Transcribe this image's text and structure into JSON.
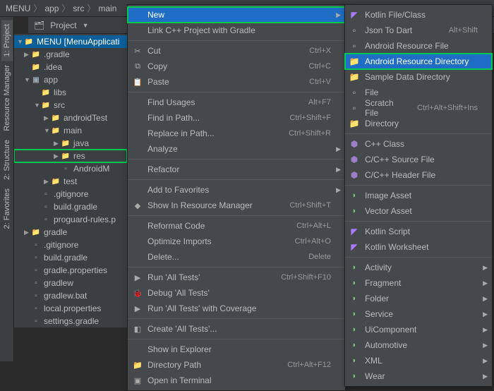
{
  "breadcrumb": [
    "MENU",
    "app",
    "src",
    "main"
  ],
  "toolbar": {
    "mode": "Project"
  },
  "side_tabs": [
    "1: Project",
    "Resource Manager",
    "2: Structure",
    "2: Favorites"
  ],
  "tree": [
    {
      "pad": 0,
      "ar": "▼",
      "ico": "folder",
      "txt": "MENU [MenuApplicati",
      "sel": true
    },
    {
      "pad": 1,
      "ar": "▶",
      "ico": "folder-o",
      "txt": ".gradle"
    },
    {
      "pad": 1,
      "ar": "",
      "ico": "folder",
      "txt": ".idea"
    },
    {
      "pad": 1,
      "ar": "▼",
      "ico": "mod",
      "txt": "app"
    },
    {
      "pad": 2,
      "ar": "",
      "ico": "folder",
      "txt": "libs"
    },
    {
      "pad": 2,
      "ar": "▼",
      "ico": "folder",
      "txt": "src"
    },
    {
      "pad": 3,
      "ar": "▶",
      "ico": "folder",
      "txt": "androidTest"
    },
    {
      "pad": 3,
      "ar": "▼",
      "ico": "folder",
      "txt": "main"
    },
    {
      "pad": 4,
      "ar": "▶",
      "ico": "folder",
      "txt": "java"
    },
    {
      "pad": 4,
      "ar": "▶",
      "ico": "folder",
      "txt": "res",
      "hl": true
    },
    {
      "pad": 4,
      "ar": "",
      "ico": "file",
      "txt": "AndroidM"
    },
    {
      "pad": 3,
      "ar": "▶",
      "ico": "folder",
      "txt": "test"
    },
    {
      "pad": 2,
      "ar": "",
      "ico": "file",
      "txt": ".gitignore"
    },
    {
      "pad": 2,
      "ar": "",
      "ico": "file",
      "txt": "build.gradle"
    },
    {
      "pad": 2,
      "ar": "",
      "ico": "file",
      "txt": "proguard-rules.p"
    },
    {
      "pad": 1,
      "ar": "▶",
      "ico": "folder",
      "txt": "gradle"
    },
    {
      "pad": 1,
      "ar": "",
      "ico": "file",
      "txt": ".gitignore"
    },
    {
      "pad": 1,
      "ar": "",
      "ico": "file",
      "txt": "build.gradle"
    },
    {
      "pad": 1,
      "ar": "",
      "ico": "file",
      "txt": "gradle.properties"
    },
    {
      "pad": 1,
      "ar": "",
      "ico": "file",
      "txt": "gradlew"
    },
    {
      "pad": 1,
      "ar": "",
      "ico": "file",
      "txt": "gradlew.bat"
    },
    {
      "pad": 1,
      "ar": "",
      "ico": "file",
      "txt": "local.properties"
    },
    {
      "pad": 1,
      "ar": "",
      "ico": "file",
      "txt": "settings.gradle"
    }
  ],
  "menu1": [
    {
      "label": "New",
      "sub": true,
      "hl": true
    },
    {
      "label": "Link C++ Project with Gradle"
    },
    {
      "sep": true
    },
    {
      "label": "Cut",
      "sc": "Ctrl+X",
      "ico": "✂"
    },
    {
      "label": "Copy",
      "sc": "Ctrl+C",
      "ico": "⧉"
    },
    {
      "label": "Paste",
      "sc": "Ctrl+V",
      "ico": "📋"
    },
    {
      "sep": true
    },
    {
      "label": "Find Usages",
      "sc": "Alt+F7"
    },
    {
      "label": "Find in Path...",
      "sc": "Ctrl+Shift+F"
    },
    {
      "label": "Replace in Path...",
      "sc": "Ctrl+Shift+R"
    },
    {
      "label": "Analyze",
      "sub": true
    },
    {
      "sep": true
    },
    {
      "label": "Refactor",
      "sub": true
    },
    {
      "sep": true
    },
    {
      "label": "Add to Favorites",
      "sub": true
    },
    {
      "label": "Show In Resource Manager",
      "sc": "Ctrl+Shift+T",
      "ico": "◆"
    },
    {
      "sep": true
    },
    {
      "label": "Reformat Code",
      "sc": "Ctrl+Alt+L"
    },
    {
      "label": "Optimize Imports",
      "sc": "Ctrl+Alt+O"
    },
    {
      "label": "Delete...",
      "sc": "Delete"
    },
    {
      "sep": true
    },
    {
      "label": "Run 'All Tests'",
      "sc": "Ctrl+Shift+F10",
      "ico": "▶"
    },
    {
      "label": "Debug 'All Tests'",
      "ico": "🐞"
    },
    {
      "label": "Run 'All Tests' with Coverage",
      "ico": "▶"
    },
    {
      "sep": true
    },
    {
      "label": "Create 'All Tests'...",
      "ico": "◧"
    },
    {
      "sep": true
    },
    {
      "label": "Show in Explorer"
    },
    {
      "label": "Directory Path",
      "sc": "Ctrl+Alt+F12",
      "ico": "📁"
    },
    {
      "label": "Open in Terminal",
      "ico": "▣"
    }
  ],
  "menu2": [
    {
      "label": "Kotlin File/Class",
      "cls": "kt"
    },
    {
      "label": "Json To Dart",
      "sc": "Alt+Shift",
      "cls": "file"
    },
    {
      "label": "Android Resource File",
      "cls": "file"
    },
    {
      "label": "Android Resource Directory",
      "hl": true,
      "cls": "folder"
    },
    {
      "label": "Sample Data Directory",
      "cls": "folder"
    },
    {
      "label": "File",
      "cls": "file"
    },
    {
      "label": "Scratch File",
      "sc": "Ctrl+Alt+Shift+Ins",
      "cls": "file"
    },
    {
      "label": "Directory",
      "cls": "folder"
    },
    {
      "sep": true
    },
    {
      "label": "C++ Class",
      "cls": "cpp"
    },
    {
      "label": "C/C++ Source File",
      "cls": "cpp"
    },
    {
      "label": "C/C++ Header File",
      "cls": "cpp"
    },
    {
      "sep": true
    },
    {
      "label": "Image Asset",
      "cls": "android"
    },
    {
      "label": "Vector Asset",
      "cls": "android"
    },
    {
      "sep": true
    },
    {
      "label": "Kotlin Script",
      "cls": "kt"
    },
    {
      "label": "Kotlin Worksheet",
      "cls": "kt"
    },
    {
      "sep": true
    },
    {
      "label": "Activity",
      "sub": true,
      "cls": "android"
    },
    {
      "label": "Fragment",
      "sub": true,
      "cls": "android"
    },
    {
      "label": "Folder",
      "sub": true,
      "cls": "android"
    },
    {
      "label": "Service",
      "sub": true,
      "cls": "android"
    },
    {
      "label": "UiComponent",
      "sub": true,
      "cls": "android"
    },
    {
      "label": "Automotive",
      "sub": true,
      "cls": "android"
    },
    {
      "label": "XML",
      "sub": true,
      "cls": "android"
    },
    {
      "label": "Wear",
      "sub": true,
      "cls": "android"
    }
  ]
}
